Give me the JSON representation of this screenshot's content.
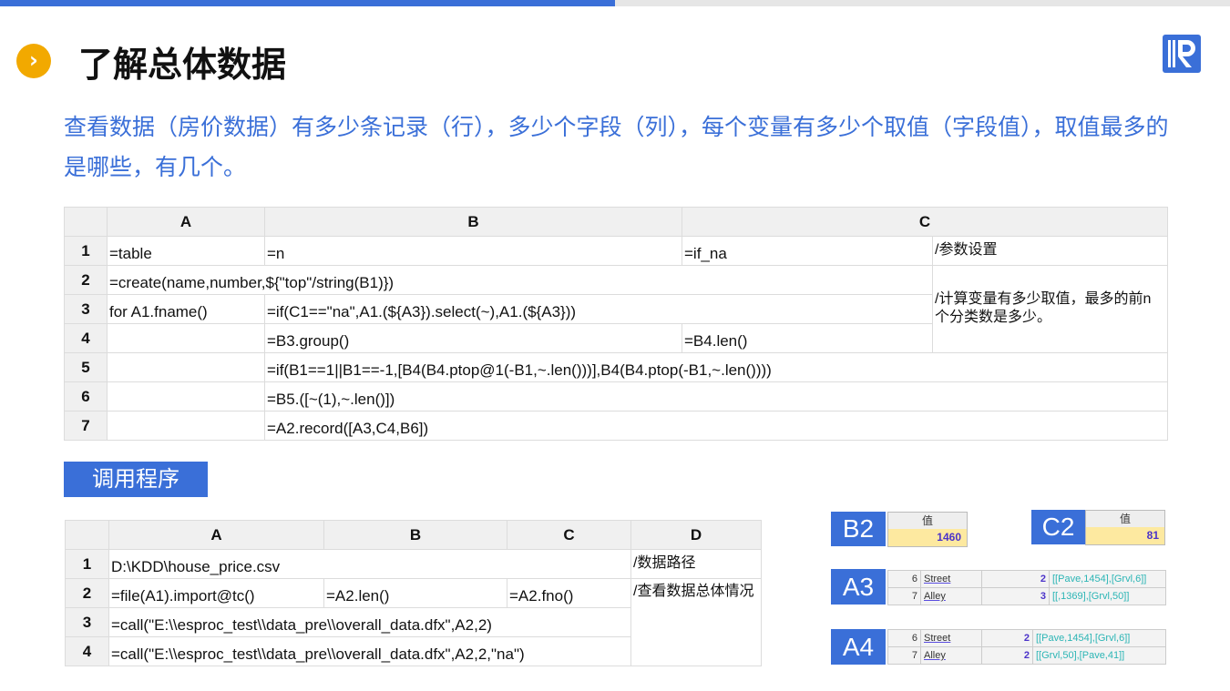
{
  "title": "了解总体数据",
  "description": "查看数据（房价数据）有多少条记录（行），多少个字段（列），每个变量有多少个取值（字段值），取值最多的是哪些，有几个。",
  "colors": {
    "accent": "#3a6fd8",
    "bullet": "#f2a900"
  },
  "icons": {
    "bullet": "chevron-right-icon",
    "logo": "r-logo-icon"
  },
  "grid1": {
    "headers": [
      "A",
      "B",
      "C"
    ],
    "rows": [
      "1",
      "2",
      "3",
      "4",
      "5",
      "6",
      "7"
    ],
    "r1": {
      "a": "=table",
      "b": "=n",
      "c": "=if_na",
      "d": "/参数设置"
    },
    "r2": {
      "a": "=create(name,number,${\"top\"/string(B1)})"
    },
    "comment2": "/计算变量有多少取值，最多的前n个分类数是多少。",
    "r3": {
      "a": "for A1.fname()",
      "b": "=if(C1==\"na\",A1.(${A3}).select(~),A1.(${A3}))"
    },
    "r4": {
      "b": "=B3.group()",
      "c": "=B4.len()"
    },
    "r5": {
      "b": "=if(B1==1||B1==-1,[B4(B4.ptop@1(-B1,~.len()))],B4(B4.ptop(-B1,~.len())))"
    },
    "r6": {
      "b": "=B5.([~(1),~.len()])"
    },
    "r7": {
      "b": "=A2.record([A3,C4,B6])"
    }
  },
  "call_label": "调用程序",
  "grid2": {
    "headers": [
      "A",
      "B",
      "C",
      "D"
    ],
    "rows": [
      "1",
      "2",
      "3",
      "4"
    ],
    "r1": {
      "a": "D:\\KDD\\house_price.csv",
      "d": "/数据路径"
    },
    "r2": {
      "a": "=file(A1).import@tc()",
      "b": "=A2.len()",
      "c": "=A2.fno()",
      "d": "/查看数据总体情况"
    },
    "r3": {
      "a": "=call(\"E:\\\\esproc_test\\\\data_pre\\\\overall_data.dfx\",A2,2)"
    },
    "r4": {
      "a": "=call(\"E:\\\\esproc_test\\\\data_pre\\\\overall_data.dfx\",A2,2,\"na\")"
    }
  },
  "results": {
    "b2": {
      "label": "B2",
      "header": "值",
      "value": "1460"
    },
    "c2": {
      "label": "C2",
      "header": "值",
      "value": "81"
    },
    "a3": {
      "label": "A3",
      "rows": [
        {
          "n": "6",
          "f": "Street",
          "c": "2",
          "v": "[[Pave,1454],[Grvl,6]]"
        },
        {
          "n": "7",
          "f": "Alley",
          "c": "3",
          "v": "[[,1369],[Grvl,50]]"
        }
      ]
    },
    "a4": {
      "label": "A4",
      "rows": [
        {
          "n": "6",
          "f": "Street",
          "c": "2",
          "v": "[[Pave,1454],[Grvl,6]]"
        },
        {
          "n": "7",
          "f": "Alley",
          "c": "2",
          "v": "[[Grvl,50],[Pave,41]]"
        }
      ]
    }
  }
}
